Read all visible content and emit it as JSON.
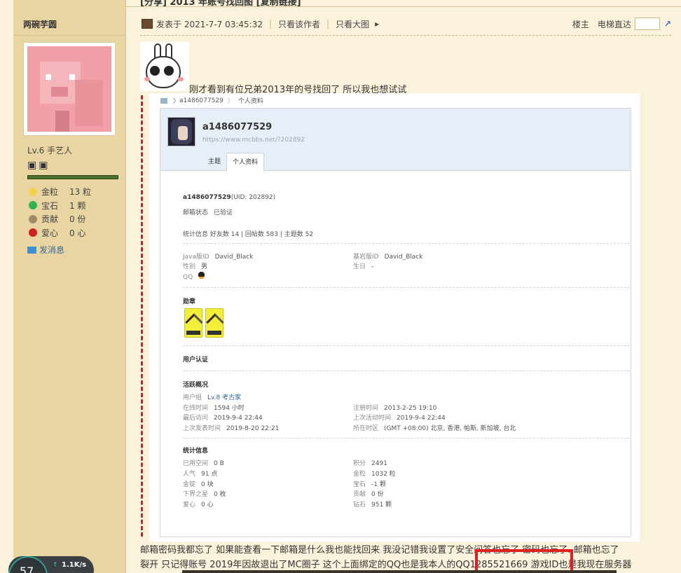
{
  "thread": {
    "title_fragment": "[分享] 2013 年账号找回图 [复制链接]"
  },
  "author": {
    "name": "两碗芋圆",
    "level": "Lv.6 手艺人",
    "badges_glyph": "▣▣",
    "stats": [
      {
        "label": "金粒",
        "value": "13 粒",
        "icon": "gold-nugget-icon",
        "color": "#f0d24a"
      },
      {
        "label": "宝石",
        "value": "1 颗",
        "icon": "emerald-icon",
        "color": "#2fb34a"
      },
      {
        "label": "贡献",
        "value": "0 份",
        "icon": "contribution-icon",
        "color": "#a08a6a"
      },
      {
        "label": "爱心",
        "value": "0 心",
        "icon": "heart-apple-icon",
        "color": "#d22020"
      }
    ],
    "send_message": "发消息"
  },
  "meta": {
    "posted_at": "发表于 2021-7-7 03:45:32",
    "only_author": "只看该作者",
    "only_big": "只看大图",
    "arrow": "▸",
    "floor": "楼主",
    "elevator": "电梯直达",
    "go_glyph": "↗"
  },
  "post": {
    "line1": "刚才看到有位兄弟2013年的号找回了 所以我也想试试",
    "line2": "邮箱密码我都忘了 如果能查看一下邮箱是什么我也能找回来  我没记错我设置了安全问答也忘了  密码也忘了..邮箱也忘了",
    "line3": "裂开 只记得账号   2019年因故退出了MC圈子    这个上面绑定的QQ也是我本人的QQ1285521669  游戏ID也是我现在服务器"
  },
  "screenshot": {
    "crumb_user": "a1486077529",
    "crumb_page": "个人资料",
    "crumb_arrow": "〉",
    "profile_name": "a1486077529",
    "profile_url": "https://www.mcbbs.net/?202892",
    "tabs": [
      "主题",
      "个人资料"
    ],
    "uid_line_name": "a1486077529",
    "uid_line_uid": "(UID: 202892)",
    "email_status_k": "邮箱状态",
    "email_status_v": "已验证",
    "stats_line": "统计信息  好友数 14  |  回帖数 583  |  主题数 52",
    "java_k": "Java版ID",
    "java_v": "David_Black",
    "bedrock_k": "基岩版ID",
    "bedrock_v": "David_Black",
    "gender_k": "性别",
    "gender_v": "男",
    "birthday_k": "生日",
    "birthday_v": "-",
    "qq_k": "QQ",
    "medals_title": "勋章",
    "verify_title": "用户认证",
    "activity_title": "活跃概况",
    "group_k": "用户组",
    "group_v": "Lv.8 考古家",
    "online_k": "在线时间",
    "online_v": "1594 小时",
    "reg_k": "注册时间",
    "reg_v": "2013-2-25 19:10",
    "lastvisit_k": "最后访问",
    "lastvisit_v": "2019-9-4 22:44",
    "lastactive_k": "上次活动时间",
    "lastactive_v": "2019-9-4 22:44",
    "lastpost_k": "上次发表时间",
    "lastpost_v": "2019-8-20 22:21",
    "tz_k": "所在时区",
    "tz_v": "(GMT +08:00) 北京, 香港, 帕斯, 新加坡, 台北",
    "info_title": "统计信息",
    "space_k": "已用空间",
    "space_v": "0 B",
    "score_k": "积分",
    "score_v": "2491",
    "pop_k": "人气",
    "pop_v": "91 点",
    "gold_k": "金粒",
    "gold_v": "1032 粒",
    "ingot_k": "金锭",
    "ingot_v": "0 块",
    "gem_k": "宝石",
    "gem_v": "-1 颗",
    "star_k": "下界之星",
    "star_v": "0 枚",
    "contrib_k": "贡献",
    "contrib_v": "0 份",
    "love_k": "爱心",
    "love_v": "0 心",
    "diamond_k": "钻石",
    "diamond_v": "951 颗"
  },
  "netmon": {
    "value": "57",
    "speed": "1.1K/s",
    "arrow": "↑"
  }
}
